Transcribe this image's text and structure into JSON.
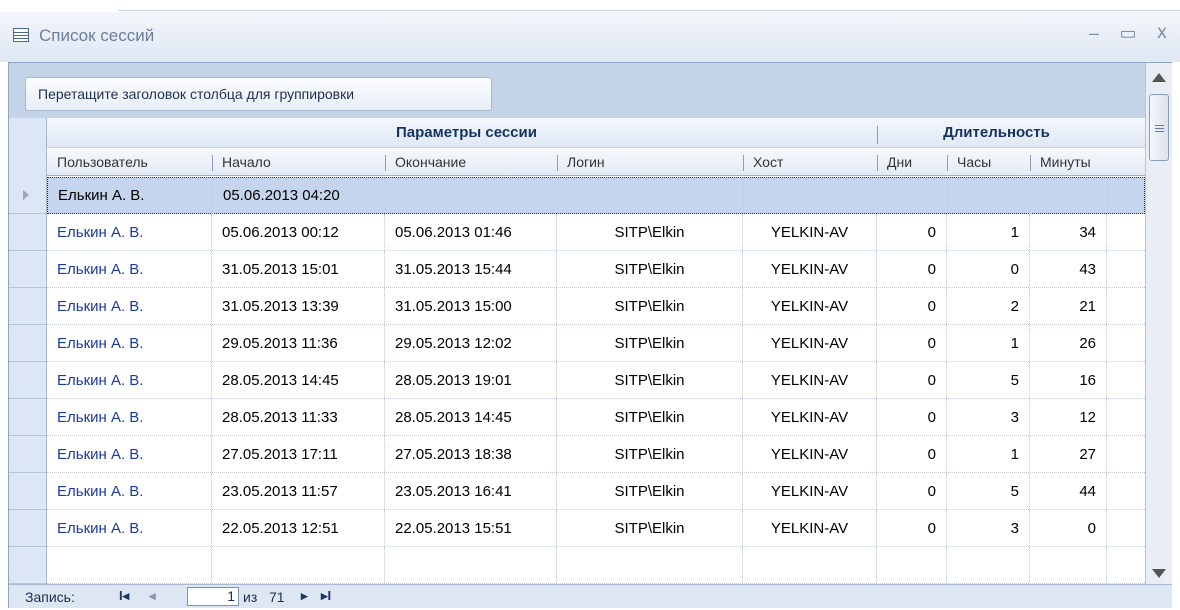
{
  "window": {
    "title": "Список сессий",
    "minimize": "–",
    "maximize": "▭",
    "close": "x"
  },
  "group_panel": {
    "hint": "Перетащите заголовок столбца для группировки"
  },
  "bands": {
    "session_params": "Параметры сессии",
    "duration": "Длительность"
  },
  "columns": [
    "Пользователь",
    "Начало",
    "Окончание",
    "Логин",
    "Хост",
    "Дни",
    "Часы",
    "Минуты"
  ],
  "current_row": {
    "user": "Елькин А. В.",
    "start": "05.06.2013 04:20"
  },
  "rows": [
    {
      "user": "Елькин А. В.",
      "start": "05.06.2013 00:12",
      "end": "05.06.2013 01:46",
      "login": "SITP\\Elkin",
      "host": "YELKIN-AV",
      "days": "0",
      "hours": "1",
      "minutes": "34"
    },
    {
      "user": "Елькин А. В.",
      "start": "31.05.2013 15:01",
      "end": "31.05.2013 15:44",
      "login": "SITP\\Elkin",
      "host": "YELKIN-AV",
      "days": "0",
      "hours": "0",
      "minutes": "43"
    },
    {
      "user": "Елькин А. В.",
      "start": "31.05.2013 13:39",
      "end": "31.05.2013 15:00",
      "login": "SITP\\Elkin",
      "host": "YELKIN-AV",
      "days": "0",
      "hours": "2",
      "minutes": "21"
    },
    {
      "user": "Елькин А. В.",
      "start": "29.05.2013 11:36",
      "end": "29.05.2013 12:02",
      "login": "SITP\\Elkin",
      "host": "YELKIN-AV",
      "days": "0",
      "hours": "1",
      "minutes": "26"
    },
    {
      "user": "Елькин А. В.",
      "start": "28.05.2013 14:45",
      "end": "28.05.2013 19:01",
      "login": "SITP\\Elkin",
      "host": "YELKIN-AV",
      "days": "0",
      "hours": "5",
      "minutes": "16"
    },
    {
      "user": "Елькин А. В.",
      "start": "28.05.2013 11:33",
      "end": "28.05.2013 14:45",
      "login": "SITP\\Elkin",
      "host": "YELKIN-AV",
      "days": "0",
      "hours": "3",
      "minutes": "12"
    },
    {
      "user": "Елькин А. В.",
      "start": "27.05.2013 17:11",
      "end": "27.05.2013 18:38",
      "login": "SITP\\Elkin",
      "host": "YELKIN-AV",
      "days": "0",
      "hours": "1",
      "minutes": "27"
    },
    {
      "user": "Елькин А. В.",
      "start": "23.05.2013 11:57",
      "end": "23.05.2013 16:41",
      "login": "SITP\\Elkin",
      "host": "YELKIN-AV",
      "days": "0",
      "hours": "5",
      "minutes": "44"
    },
    {
      "user": "Елькин А. В.",
      "start": "22.05.2013 12:51",
      "end": "22.05.2013 15:51",
      "login": "SITP\\Elkin",
      "host": "YELKIN-AV",
      "days": "0",
      "hours": "3",
      "minutes": "0"
    }
  ],
  "navigator": {
    "label": "Запись:",
    "first": "I◂",
    "prev": "◂",
    "current": "1",
    "of": "из",
    "total": "71",
    "next": "▸",
    "last": "▸I"
  }
}
